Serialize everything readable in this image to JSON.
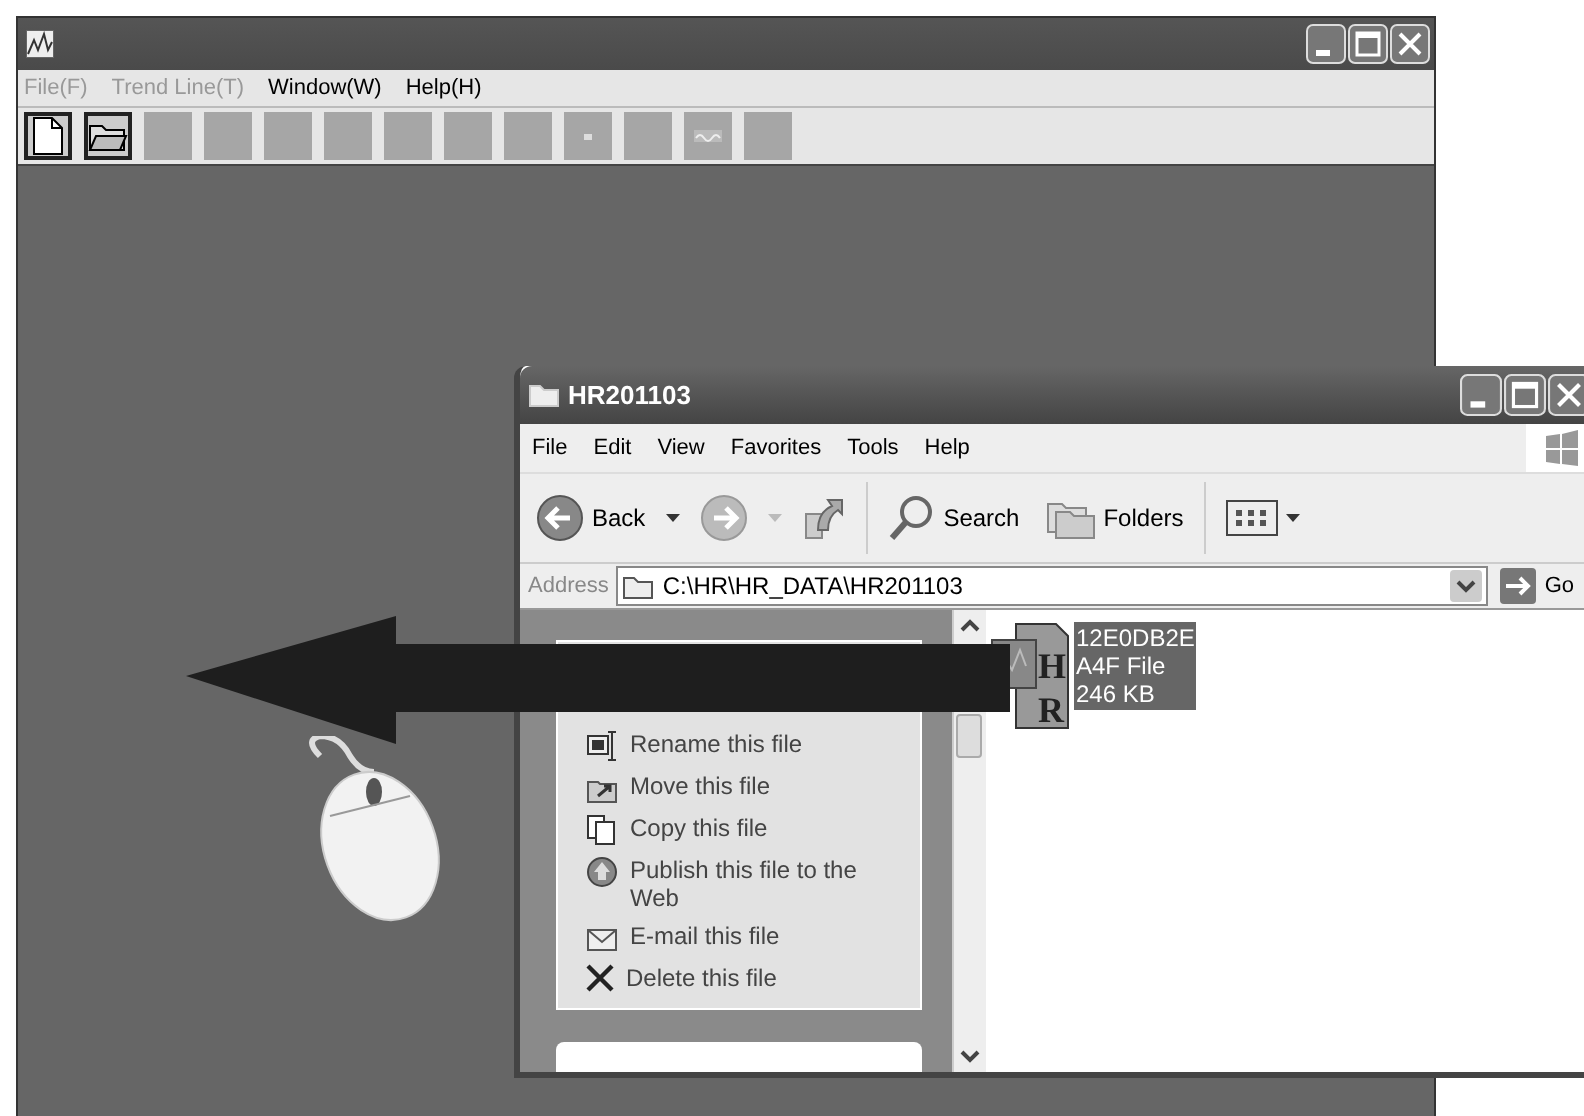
{
  "main_window": {
    "menu": [
      {
        "label": "File(F)",
        "disabled": true
      },
      {
        "label": "Trend Line(T)",
        "disabled": true
      },
      {
        "label": "Window(W)",
        "disabled": false
      },
      {
        "label": "Help(H)",
        "disabled": false
      }
    ],
    "toolbar": [
      {
        "kind": "new",
        "disabled": false
      },
      {
        "kind": "open",
        "disabled": false
      },
      {
        "kind": "blank",
        "disabled": true
      },
      {
        "kind": "blank",
        "disabled": true
      },
      {
        "kind": "blank",
        "disabled": true
      },
      {
        "kind": "blank",
        "disabled": true
      },
      {
        "kind": "blank",
        "disabled": true
      },
      {
        "kind": "blank",
        "disabled": true
      },
      {
        "kind": "blank",
        "disabled": true
      },
      {
        "kind": "dot",
        "disabled": true
      },
      {
        "kind": "blank",
        "disabled": true
      },
      {
        "kind": "wave",
        "disabled": true
      },
      {
        "kind": "blank",
        "disabled": true
      }
    ]
  },
  "explorer": {
    "title": "HR201103",
    "menu": [
      "File",
      "Edit",
      "View",
      "Favorites",
      "Tools",
      "Help"
    ],
    "toolbar": [
      {
        "kind": "back",
        "label": "Back"
      },
      {
        "kind": "forward"
      },
      {
        "kind": "up"
      },
      {
        "kind": "search",
        "label": "Search"
      },
      {
        "kind": "folders",
        "label": "Folders"
      },
      {
        "kind": "views"
      }
    ],
    "address": {
      "label": "Address",
      "value": "C:\\HR\\HR_DATA\\HR201103",
      "go": "Go"
    },
    "tasks": [
      {
        "kind": "rename",
        "label": "Rename this file"
      },
      {
        "kind": "move",
        "label": "Move this file"
      },
      {
        "kind": "copy",
        "label": "Copy this file"
      },
      {
        "kind": "publish",
        "label": "Publish this file to the Web"
      },
      {
        "kind": "email",
        "label": "E-mail this file"
      },
      {
        "kind": "delete",
        "label": "Delete this file"
      }
    ],
    "file": {
      "icon_letters": [
        "H",
        "R"
      ],
      "lines": [
        "12E0DB2E",
        "A4F File",
        "246 KB"
      ],
      "selected": true
    }
  }
}
